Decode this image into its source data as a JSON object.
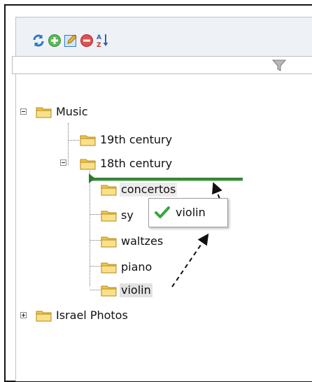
{
  "colors": {
    "frame": "#141414",
    "toolbar_bg": "#eef1f5",
    "folder": "#f4c64b",
    "drop_indicator": "#3c8a3c",
    "check": "#3aa63a"
  },
  "toolbar": {
    "buttons": [
      {
        "name": "refresh",
        "icon": "refresh-icon"
      },
      {
        "name": "add",
        "icon": "add-icon"
      },
      {
        "name": "edit",
        "icon": "edit-icon"
      },
      {
        "name": "delete",
        "icon": "delete-icon"
      },
      {
        "name": "sort",
        "icon": "sort-az-icon"
      }
    ]
  },
  "filter": {
    "value": "",
    "icon": "filter-icon"
  },
  "tree": {
    "music": {
      "label": "Music",
      "expanded": true
    },
    "century19": {
      "label": "19th century"
    },
    "century18": {
      "label": "18th century",
      "expanded": true
    },
    "children": [
      {
        "label": "concertos"
      },
      {
        "label": "sy"
      },
      {
        "label": "waltzes"
      },
      {
        "label": "piano"
      },
      {
        "label": "violin",
        "selected": true
      }
    ],
    "israel": {
      "label": "Israel Photos",
      "expanded": false
    }
  },
  "drag": {
    "label": "violin",
    "status_icon": "check-icon"
  }
}
